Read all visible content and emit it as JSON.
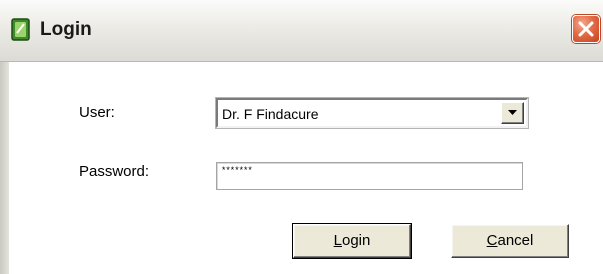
{
  "window": {
    "title": "Login"
  },
  "form": {
    "user_label": "User:",
    "user_value": "Dr. F Findacure",
    "password_label": "Password:",
    "password_value": "*******"
  },
  "buttons": {
    "login_first": "L",
    "login_rest": "ogin",
    "cancel_first": "C",
    "cancel_rest": "ancel"
  },
  "icons": {
    "app": "app-icon",
    "close": "close-icon",
    "dropdown": "chevron-down-icon"
  },
  "colors": {
    "close_button": "#d9542e",
    "button_face": "#ece9d8",
    "title_text": "#1a1a1a"
  }
}
